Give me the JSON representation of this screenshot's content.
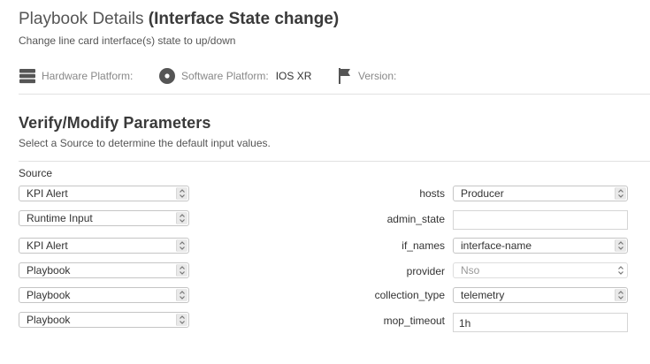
{
  "header": {
    "title_prefix": "Playbook Details ",
    "title_name": "(Interface State change)",
    "subtitle": "Change line card interface(s) state to up/down"
  },
  "meta": {
    "hardware_label": "Hardware Platform:",
    "hardware_value": "",
    "software_label": "Software Platform:",
    "software_value": "IOS XR",
    "version_label": "Version:",
    "version_value": ""
  },
  "section": {
    "title": "Verify/Modify Parameters",
    "description": "Select a Source to determine the default input values.",
    "source_label": "Source"
  },
  "rows": [
    {
      "source": "KPI Alert",
      "param": "hosts",
      "value": "Producer",
      "control": "select"
    },
    {
      "source": "Runtime Input",
      "param": "admin_state",
      "value": "",
      "control": "input"
    },
    {
      "source": "KPI Alert",
      "param": "if_names",
      "value": "interface-name",
      "control": "select"
    },
    {
      "source": "Playbook",
      "param": "provider",
      "value": "Nso",
      "control": "select-disabled"
    },
    {
      "source": "Playbook",
      "param": "collection_type",
      "value": "telemetry",
      "control": "select"
    },
    {
      "source": "Playbook",
      "param": "mop_timeout",
      "value": "1h",
      "control": "input"
    }
  ]
}
